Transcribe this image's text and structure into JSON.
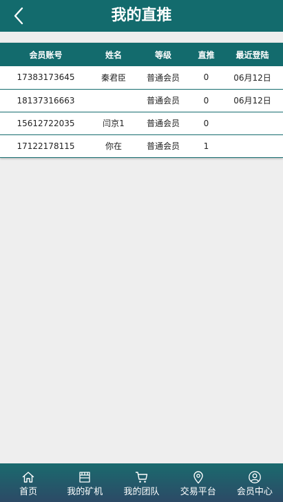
{
  "header": {
    "title": "我的直推",
    "back_icon": "chevron-left-icon"
  },
  "table": {
    "columns": [
      "会员账号",
      "姓名",
      "等级",
      "直推",
      "最近登陆"
    ],
    "rows": [
      [
        "17383173645",
        "秦君臣",
        "普通会员",
        "0",
        "06月12日"
      ],
      [
        "18137316663",
        "",
        "普通会员",
        "0",
        "06月12日"
      ],
      [
        "15612722035",
        "闫京1",
        "普通会员",
        "0",
        ""
      ],
      [
        "17122178115",
        "你在",
        "普通会员",
        "1",
        ""
      ]
    ]
  },
  "nav": {
    "items": [
      {
        "label": "首页",
        "icon": "home-icon"
      },
      {
        "label": "我的矿机",
        "icon": "store-icon"
      },
      {
        "label": "我的团队",
        "icon": "cart-icon"
      },
      {
        "label": "交易平台",
        "icon": "location-pin-icon"
      },
      {
        "label": "会员中心",
        "icon": "user-icon"
      }
    ]
  },
  "colors": {
    "primary": "#136b6d",
    "nav_gradient_bottom": "#2c4a66",
    "background": "#eeeeee"
  }
}
